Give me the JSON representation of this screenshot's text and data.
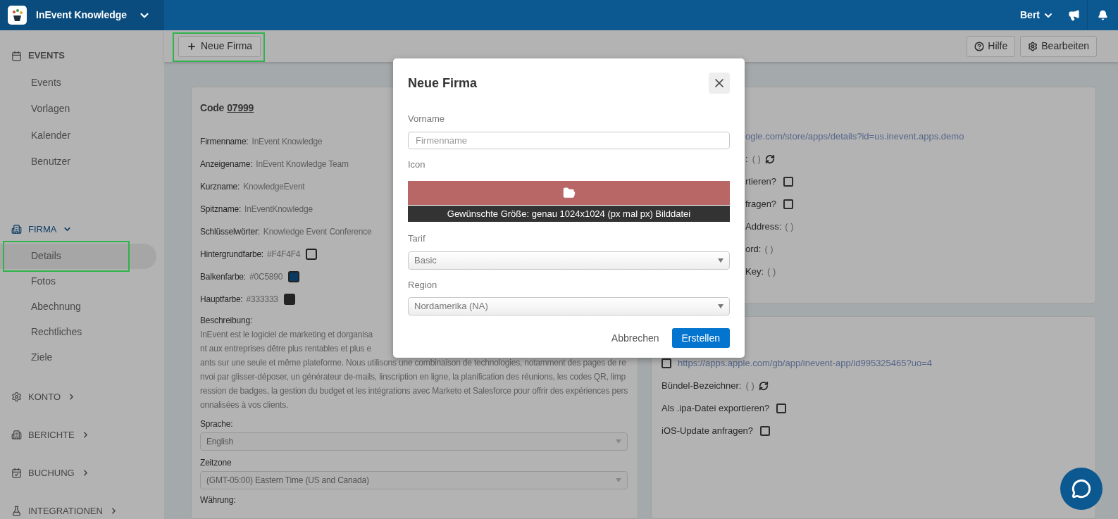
{
  "topbar": {
    "brand": "InEvent Knowledge",
    "user": "Bert"
  },
  "sidebar": {
    "sections": [
      {
        "kind": "group",
        "label": "EVENTS",
        "selected": false,
        "items": [
          {
            "label": "Events",
            "selected": false
          },
          {
            "label": "Vorlagen",
            "selected": false
          },
          {
            "label": "Kalender",
            "selected": false
          },
          {
            "label": "Benutzer",
            "selected": false
          }
        ]
      },
      {
        "kind": "collapsible",
        "label": "FIRMA",
        "selected": true,
        "expanded": true,
        "items": [
          {
            "label": "Details",
            "selected": true
          },
          {
            "label": "Fotos",
            "selected": false
          },
          {
            "label": "Abechnung",
            "selected": false
          },
          {
            "label": "Rechtliches",
            "selected": false
          },
          {
            "label": "Ziele",
            "selected": false
          }
        ]
      },
      {
        "kind": "collapsible",
        "label": "KONTO",
        "selected": false,
        "expanded": false
      },
      {
        "kind": "collapsible",
        "label": "BERICHTE",
        "selected": false,
        "expanded": false
      },
      {
        "kind": "collapsible",
        "label": "BUCHUNG",
        "selected": false,
        "expanded": false
      },
      {
        "kind": "collapsible",
        "label": "INTEGRATIONEN",
        "selected": false,
        "expanded": false
      }
    ]
  },
  "toolbar": {
    "new_button": "Neue Firma",
    "help_button": "Hilfe",
    "edit_button": "Bearbeiten"
  },
  "details_card": {
    "code_label": "Code",
    "code": "07999",
    "fields": [
      {
        "kind": "text",
        "label": "Firmenname:",
        "value": "InEvent Knowledge"
      },
      {
        "kind": "text",
        "label": "Anzeigename:",
        "value": "InEvent Knowledge Team"
      },
      {
        "kind": "text",
        "label": "Kurzname:",
        "value": "KnowledgeEvent"
      },
      {
        "kind": "text",
        "label": "Spitzname:",
        "value": "InEventKnowledge"
      },
      {
        "kind": "text",
        "label": "Schlüsselwörter:",
        "value": "Knowledge Event Conference"
      },
      {
        "kind": "color",
        "label": "Hintergrundfarbe:",
        "value": "#F4F4F4",
        "color": "#b0b0b0"
      },
      {
        "kind": "color",
        "label": "Balkenfarbe:",
        "value": "#0C5890",
        "color": "#0a3a62"
      },
      {
        "kind": "color",
        "label": "Hauptfarbe:",
        "value": "#333333",
        "color": "#232323"
      }
    ],
    "description": {
      "label": "Beschreibung:",
      "visible_lines": [
        "InEvent est le logiciel de marketing et dorganisa",
        "nt aux entreprises dêtre plus rentables et plus e"
      ],
      "paragraph": "ants sur une seule et même plateforme. Nous utilisons une combinaison de technologies, notamment des pages de renvoi par glisser-déposer, un générateur de-mails, linscription en ligne, la planification des réunions, les codes QR, limpression de badges, la gestion du budget et les intégrations avec Marketo et Salesforce pour offrir des expériences personnalisées à vos clients."
    },
    "selects": [
      {
        "label": "Sprache:",
        "value": "English"
      },
      {
        "label": "Zeitzone",
        "value": "(GMT-05:00) Eastern Time (US and Canada)"
      }
    ],
    "last_label": "Währung:"
  },
  "android_card": {
    "rows": [
      {
        "kind": "link",
        "text": "ogle.com/store/apps/details?id=us.inevent.apps.demo"
      },
      {
        "kind": "refresh-field",
        "label": ":",
        "value": "( )"
      },
      {
        "kind": "checkbox",
        "label": "rtieren?",
        "checked": false
      },
      {
        "kind": "checkbox",
        "label": "fragen?",
        "checked": false
      },
      {
        "kind": "field",
        "label": "Address:",
        "value": "( )"
      },
      {
        "kind": "field",
        "label": "ord:",
        "value": "( )"
      },
      {
        "kind": "field",
        "label": "Key:",
        "value": "( )"
      }
    ]
  },
  "ios_card": {
    "rows": [
      {
        "kind": "checkbox-link",
        "text": "https://apps.apple.com/gb/app/inevent-app/id995325465?uo=4",
        "checked": false
      },
      {
        "kind": "refresh-field",
        "label": "Bündel-Bezeichner:",
        "value": "( )"
      },
      {
        "kind": "checkbox",
        "label": "Als .ipa-Datei exportieren?",
        "checked": false
      },
      {
        "kind": "checkbox",
        "label": "iOS-Update anfragen?",
        "checked": false
      }
    ]
  },
  "modal": {
    "title": "Neue Firma",
    "fields": [
      {
        "kind": "input",
        "label": "Vorname",
        "placeholder": "Firmenname"
      },
      {
        "kind": "upload",
        "label": "Icon",
        "caption": "Gewünschte Größe: genau 1024x1024 (px mal px) Bilddatei"
      },
      {
        "kind": "select",
        "label": "Tarif",
        "value": "Basic"
      },
      {
        "kind": "select",
        "label": "Region",
        "value": "Nordamerika (NA)"
      }
    ],
    "cancel": "Abbrechen",
    "submit": "Erstellen"
  }
}
